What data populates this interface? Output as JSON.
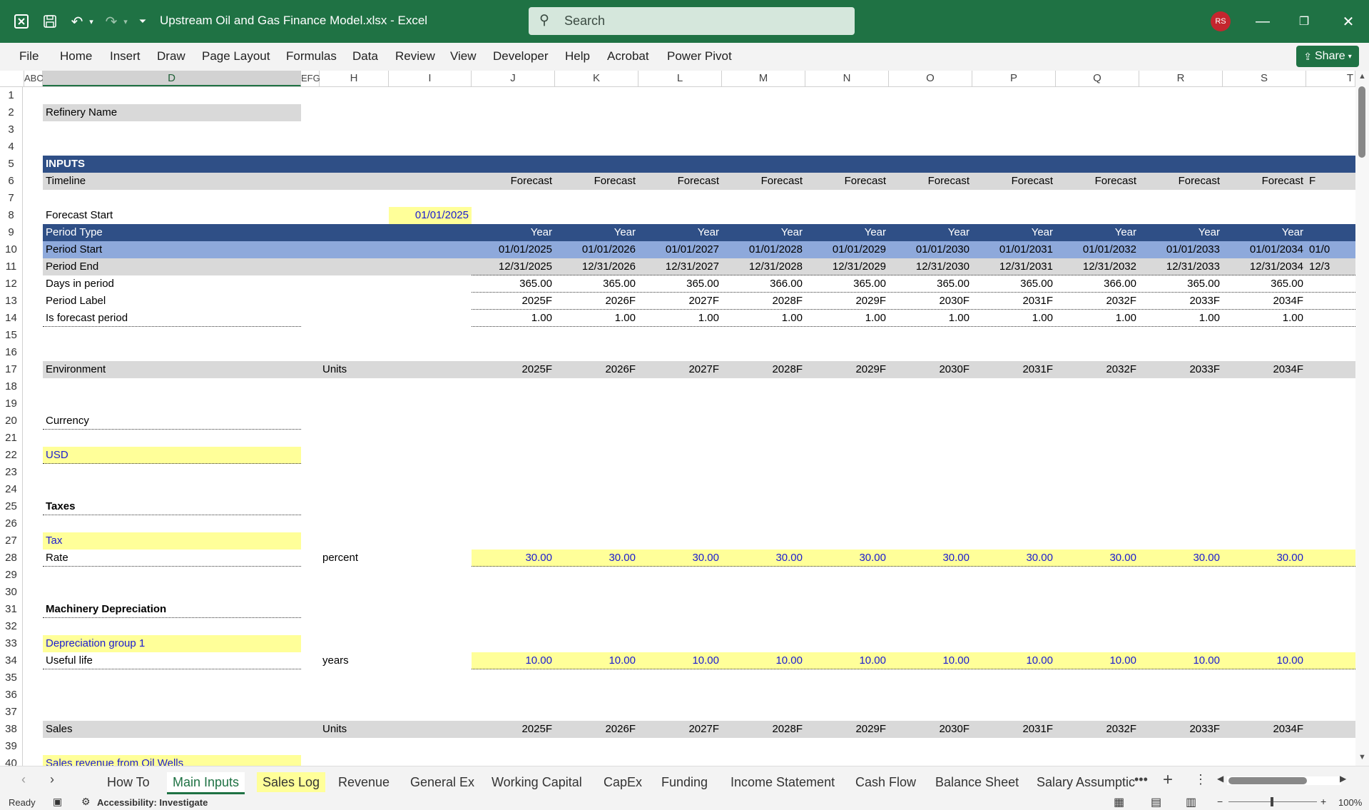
{
  "window": {
    "title": "Upstream Oil and Gas Finance Model.xlsx  -  Excel",
    "search_placeholder": "Search",
    "user_initials": "RS"
  },
  "ribbon": {
    "menu": [
      "File",
      "Home",
      "Insert",
      "Draw",
      "Page Layout",
      "Formulas",
      "Data",
      "Review",
      "View",
      "Developer",
      "Help",
      "Acrobat",
      "Power Pivot"
    ],
    "share_label": "Share"
  },
  "columns": [
    "ABC",
    "D",
    "EFG",
    "H",
    "I",
    "J",
    "K",
    "L",
    "M",
    "N",
    "O",
    "P",
    "Q",
    "R",
    "S",
    "T"
  ],
  "rows": [
    "1",
    "2",
    "3",
    "4",
    "5",
    "6",
    "7",
    "8",
    "9",
    "10",
    "11",
    "12",
    "13",
    "14",
    "15",
    "16",
    "17",
    "18",
    "19",
    "20",
    "21",
    "22",
    "23",
    "24",
    "25",
    "26",
    "27",
    "28",
    "29",
    "30",
    "31",
    "32",
    "33",
    "34",
    "35",
    "36",
    "37",
    "38",
    "39",
    "40"
  ],
  "sheet": {
    "refinery_label": "Refinery Name",
    "inputs_header": "INPUTS",
    "timeline_label": "Timeline",
    "forecast_word": "Forecast",
    "forecast_truncated": "F",
    "forecast_start_label": "Forecast Start",
    "forecast_start_value": "01/01/2025",
    "period_type_label": "Period Type",
    "period_type_value": "Year",
    "period_start_label": "Period Start",
    "period_end_label": "Period End",
    "days_label": "Days in period",
    "period_label_label": "Period Label",
    "is_forecast_label": "Is forecast period",
    "period_start": [
      "01/01/2025",
      "01/01/2026",
      "01/01/2027",
      "01/01/2028",
      "01/01/2029",
      "01/01/2030",
      "01/01/2031",
      "01/01/2032",
      "01/01/2033",
      "01/01/2034"
    ],
    "period_start_truncated": "01/0",
    "period_end": [
      "12/31/2025",
      "12/31/2026",
      "12/31/2027",
      "12/31/2028",
      "12/31/2029",
      "12/31/2030",
      "12/31/2031",
      "12/31/2032",
      "12/31/2033",
      "12/31/2034"
    ],
    "period_end_truncated": "12/3",
    "days": [
      "365.00",
      "365.00",
      "365.00",
      "366.00",
      "365.00",
      "365.00",
      "365.00",
      "366.00",
      "365.00",
      "365.00"
    ],
    "labels": [
      "2025F",
      "2026F",
      "2027F",
      "2028F",
      "2029F",
      "2030F",
      "2031F",
      "2032F",
      "2033F",
      "2034F"
    ],
    "is_forecast": [
      "1.00",
      "1.00",
      "1.00",
      "1.00",
      "1.00",
      "1.00",
      "1.00",
      "1.00",
      "1.00",
      "1.00"
    ],
    "environment_label": "Environment",
    "units_label": "Units",
    "currency_label": "Currency",
    "currency_value": "USD",
    "taxes_label": "Taxes",
    "tax_label": "Tax",
    "rate_label": "Rate",
    "rate_unit": "percent",
    "rate_values": [
      "30.00",
      "30.00",
      "30.00",
      "30.00",
      "30.00",
      "30.00",
      "30.00",
      "30.00",
      "30.00",
      "30.00"
    ],
    "machinery_label": "Machinery Depreciation",
    "dep_group_label": "Depreciation group 1",
    "useful_life_label": "Useful life",
    "useful_life_unit": "years",
    "useful_life_values": [
      "10.00",
      "10.00",
      "10.00",
      "10.00",
      "10.00",
      "10.00",
      "10.00",
      "10.00",
      "10.00",
      "10.00"
    ],
    "sales_label": "Sales",
    "sales_revenue_label": "Sales revenue from Oil Wells"
  },
  "tabs": [
    "How To",
    "Main Inputs",
    "Sales Log",
    "Revenue",
    "General Ex",
    "Working Capital",
    "CapEx",
    "Funding",
    "Income Statement",
    "Cash Flow",
    "Balance Sheet",
    "Salary Assumptic"
  ],
  "active_tab": "Main Inputs",
  "status": {
    "ready": "Ready",
    "accessibility": "Accessibility: Investigate",
    "zoom": "100%"
  },
  "colors": {
    "excel_green": "#1f7244",
    "header_navy": "#2f4f86",
    "period_start_band": "#8ea9db",
    "grey_band": "#d9d9d9",
    "input_yellow": "#ffff99",
    "input_blue_text": "#1b1bd0"
  }
}
